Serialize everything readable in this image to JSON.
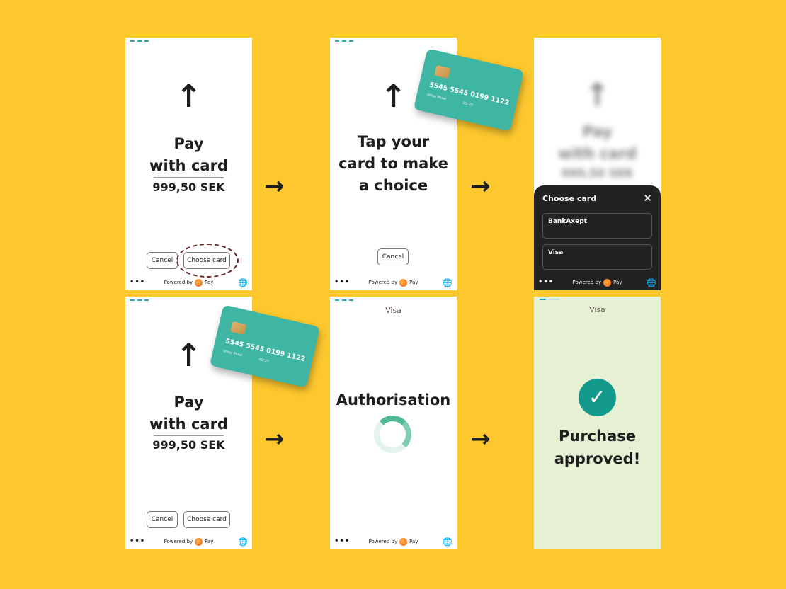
{
  "screens": {
    "pay": {
      "title_line1": "Pay",
      "title_line2": "with card",
      "amount": "999,50 SEK",
      "cancel": "Cancel",
      "choose_card": "Choose card"
    },
    "tap": {
      "line1": "Tap your",
      "line2": "card to make",
      "line3": "a choice",
      "cancel": "Cancel"
    },
    "choose": {
      "sheet_title": "Choose card",
      "options": [
        "BankAxept",
        "Visa"
      ]
    },
    "auth": {
      "card_label": "Visa",
      "title": "Authorisation"
    },
    "approved": {
      "card_label": "Visa",
      "line1": "Purchase",
      "line2": "approved!"
    }
  },
  "footer": {
    "powered_by": "Powered by",
    "brand": "Pay",
    "menu": "•••"
  },
  "card": {
    "number": "5545 5545 0199 1122",
    "name": "Orhay Rhaei",
    "expiry": "01/ 23"
  },
  "flow_arrow": "→",
  "colors": {
    "background": "#FDC72E",
    "card": "#3FB5A3",
    "success": "#149A8C",
    "approved_bg": "#E6F0D3",
    "highlight": "#6B2A2A"
  }
}
